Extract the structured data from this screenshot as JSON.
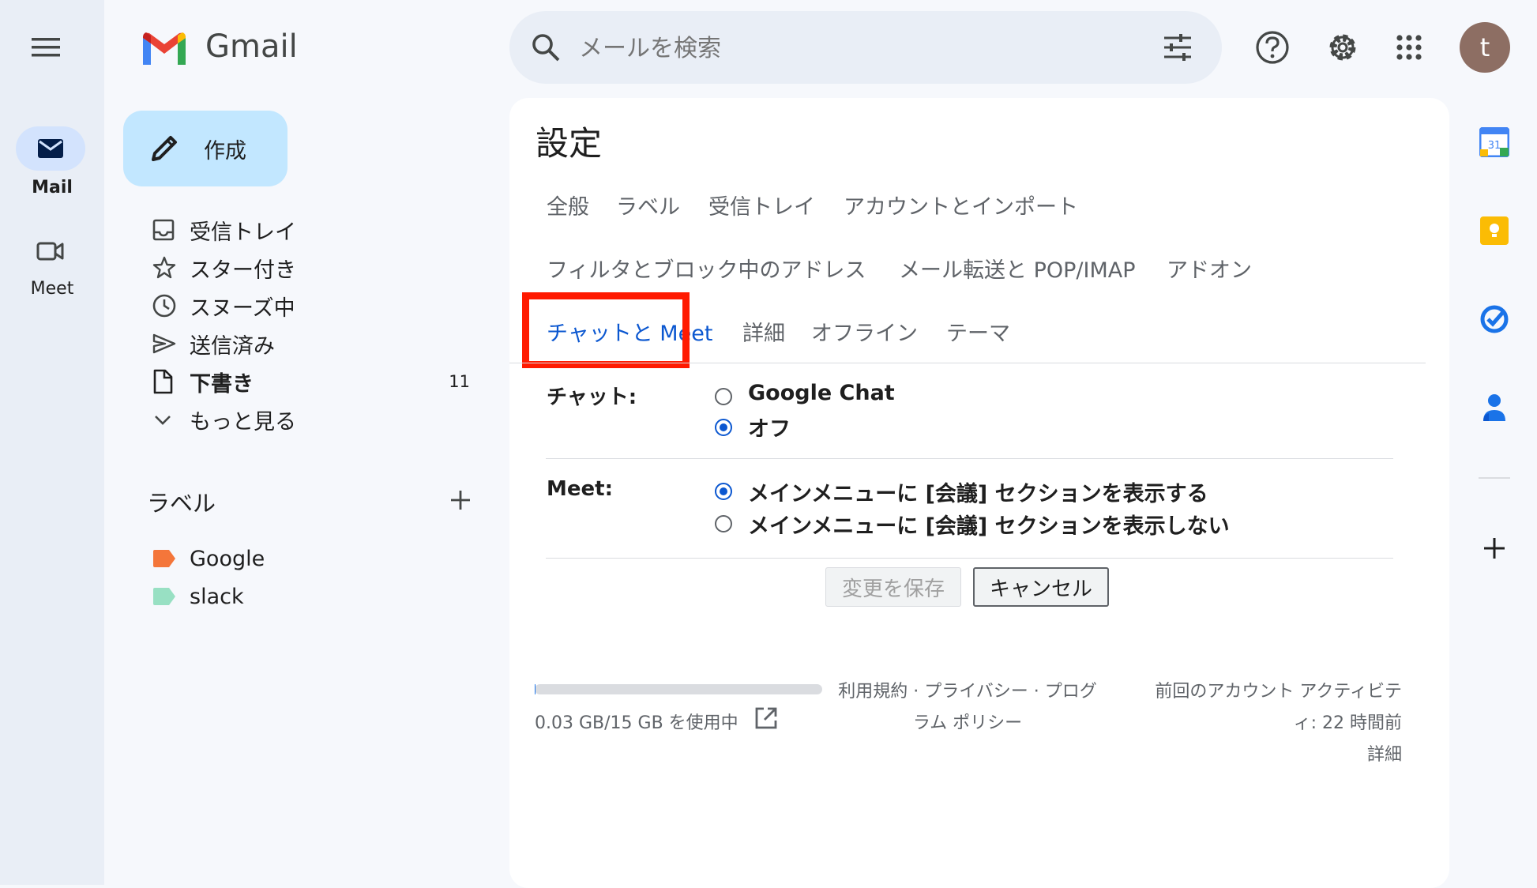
{
  "app": {
    "name": "Gmail"
  },
  "rail": {
    "items": [
      {
        "label": "Mail",
        "icon": "mail-icon",
        "active": true
      },
      {
        "label": "Meet",
        "icon": "video-icon",
        "active": false
      }
    ]
  },
  "compose": {
    "label": "作成"
  },
  "nav": [
    {
      "label": "受信トレイ",
      "icon": "inbox-icon",
      "count": ""
    },
    {
      "label": "スター付き",
      "icon": "star-icon",
      "count": ""
    },
    {
      "label": "スヌーズ中",
      "icon": "clock-icon",
      "count": ""
    },
    {
      "label": "送信済み",
      "icon": "send-icon",
      "count": ""
    },
    {
      "label": "下書き",
      "icon": "draft-icon",
      "count": "11"
    },
    {
      "label": "もっと見る",
      "icon": "chevron-down-icon",
      "count": ""
    }
  ],
  "labels": {
    "heading": "ラベル",
    "items": [
      {
        "name": "Google",
        "color": "#f4763a"
      },
      {
        "name": "slack",
        "color": "#98e0c3"
      }
    ]
  },
  "search": {
    "placeholder": "メールを検索"
  },
  "avatar": {
    "initial": "t",
    "color": "#8d6e63"
  },
  "settings": {
    "title": "設定",
    "tabs_row1": [
      "全般",
      "ラベル",
      "受信トレイ",
      "アカウントとインポート"
    ],
    "tabs_row2": [
      "フィルタとブロック中のアドレス",
      "メール転送と POP/IMAP",
      "アドオン"
    ],
    "active_tab": "チャットと Meet",
    "tabs_row3": [
      "詳細",
      "オフライン",
      "テーマ"
    ],
    "chat": {
      "label": "チャット:",
      "options": [
        {
          "label": "Google Chat",
          "selected": false
        },
        {
          "label": "オフ",
          "selected": true
        }
      ]
    },
    "meet": {
      "label": "Meet:",
      "options": [
        {
          "label": "メインメニューに [会議] セクションを表示する",
          "selected": true
        },
        {
          "label": "メインメニューに [会議] セクションを表示しない",
          "selected": false
        }
      ]
    },
    "save_label": "変更を保存",
    "cancel_label": "キャンセル"
  },
  "footer": {
    "storage": "0.03 GB/15 GB を使用中",
    "storage_fraction": 0.002,
    "policy_line1": "利用規約 · プライバシー · プログ",
    "policy_line2": "ラム ポリシー",
    "activity_line1": "前回のアカウント アクティビテ",
    "activity_line2": "ィ: 22 時間前",
    "details": "詳細"
  },
  "colors": {
    "highlight": "#ff1a00",
    "accent": "#0b57d0",
    "compose_bg": "#c2e7ff"
  }
}
